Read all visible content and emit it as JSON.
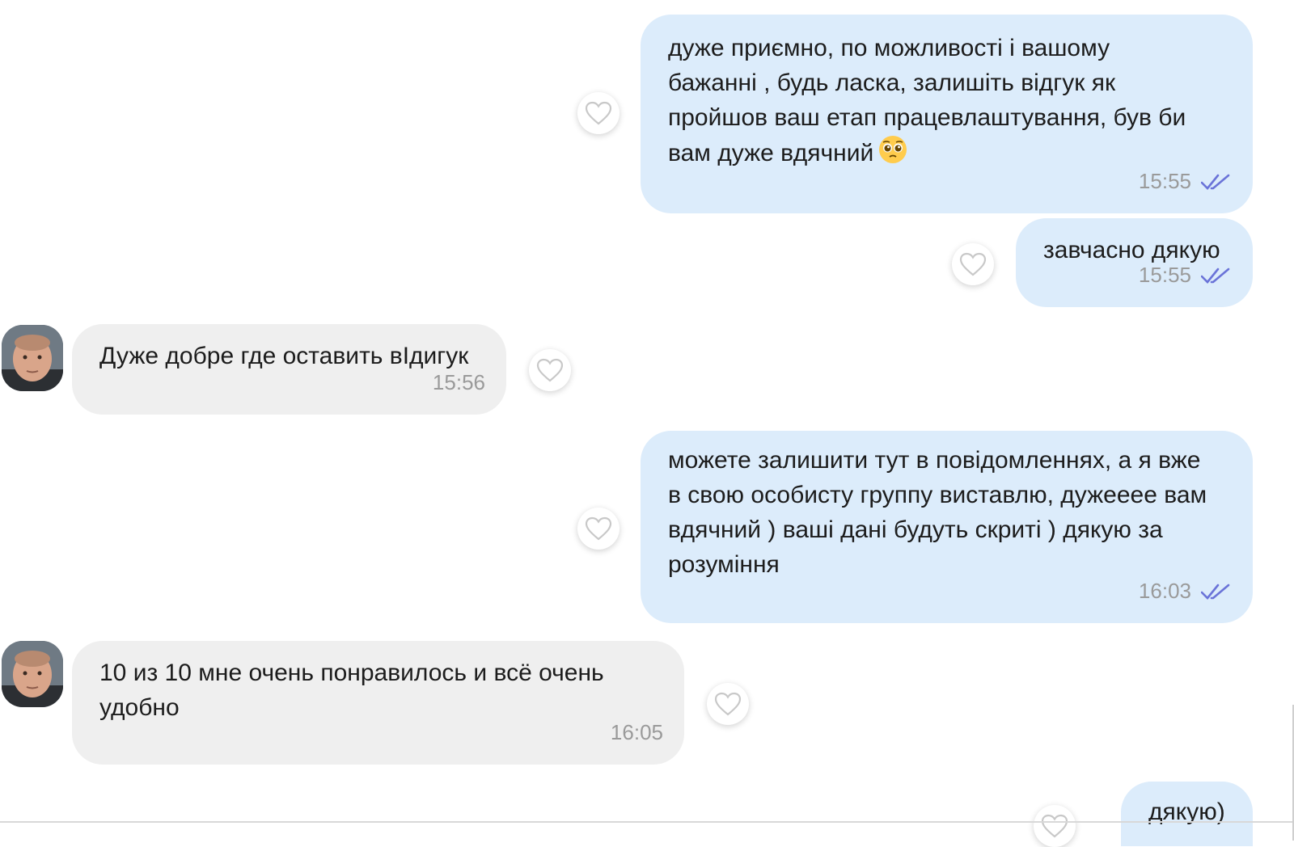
{
  "chat": {
    "msg1": {
      "text": "дуже приємно, по можливості і вашому\nбажанні , будь ласка, залишіть відгук як\nпройшов ваш етап працевлаштування, був би\nвам дуже вдячний",
      "emoji": "pleading-face",
      "time": "15:55",
      "status": "read"
    },
    "msg2": {
      "text": "завчасно дякую",
      "time": "15:55",
      "status": "read"
    },
    "msg3": {
      "text": "Дуже добре где оставить вIдигук",
      "time": "15:56"
    },
    "msg4": {
      "text": "можете залишити тут в повідомленнях, а я вже\nв свою особисту группу виставлю, дужееее вам\nвдячний ) ваші дані будуть скриті ) дякую за\nрозуміння",
      "time": "16:03",
      "status": "read"
    },
    "msg5": {
      "text": "10 из 10 мне очень понравилось и всё очень\nудобно",
      "time": "16:05"
    },
    "msg6": {
      "text": "дякую)"
    }
  },
  "icons": {
    "like": "heart-icon",
    "read": "double-check-icon",
    "avatar": "user-photo"
  },
  "colors": {
    "outgoing": "#dcecfb",
    "incoming": "#efefef",
    "check": "#6a73d8",
    "time": "#9a9a9a"
  }
}
